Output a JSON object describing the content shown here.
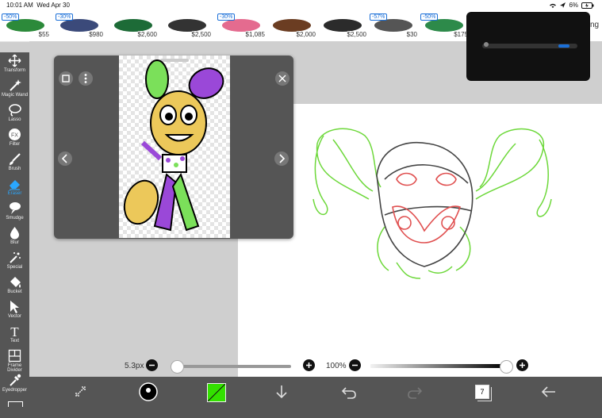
{
  "status_bar": {
    "time": "10:01 AM",
    "date": "Wed Apr 30",
    "battery": "6%"
  },
  "ads": [
    {
      "discount": "-50%",
      "price": "$55",
      "color": "#2c8a3a"
    },
    {
      "discount": "-30%",
      "price": "$980",
      "color": "#3b4a7a"
    },
    {
      "discount": "",
      "price": "$2,600",
      "color": "#1d6b37"
    },
    {
      "discount": "",
      "price": "$2,500",
      "color": "#333333"
    },
    {
      "discount": "-30%",
      "price": "$1,085",
      "color": "#e46b8f"
    },
    {
      "discount": "",
      "price": "$2,000",
      "color": "#6b3d22"
    },
    {
      "discount": "",
      "price": "$2,500",
      "color": "#2b2b2b"
    },
    {
      "discount": "-57%",
      "price": "$30",
      "color": "#555555"
    },
    {
      "discount": "-50%",
      "price": "$175",
      "color": "#2d8a4a"
    }
  ],
  "ad_trailing_text": "ng",
  "tools": [
    {
      "label": "Transform",
      "icon": "move-icon"
    },
    {
      "label": "Magic Wand",
      "icon": "magic-wand-icon"
    },
    {
      "label": "Lasso",
      "icon": "lasso-icon"
    },
    {
      "label": "Filter",
      "icon": "fx-icon",
      "glyph": "FX"
    },
    {
      "label": "Brush",
      "icon": "brush-icon"
    },
    {
      "label": "Eraser",
      "icon": "eraser-icon",
      "active": true
    },
    {
      "label": "Smudge",
      "icon": "smudge-icon"
    },
    {
      "label": "Blur",
      "icon": "blur-drop-icon"
    },
    {
      "label": "Special",
      "icon": "special-icon"
    },
    {
      "label": "Bucket",
      "icon": "bucket-icon"
    },
    {
      "label": "Vector",
      "icon": "vector-cursor-icon"
    },
    {
      "label": "Text",
      "icon": "text-icon",
      "glyph": "T"
    },
    {
      "label": "Frame Divider",
      "icon": "frame-divider-icon"
    },
    {
      "label": "Eyedropper",
      "icon": "eyedropper-icon"
    }
  ],
  "brush_size": "5.3px",
  "brush_size_fraction": 0.03,
  "opacity": "100%",
  "opacity_fraction": 1.0,
  "layer_count": "7",
  "colors": {
    "accent": "#2aa8ff",
    "current_color": "#33e000"
  }
}
